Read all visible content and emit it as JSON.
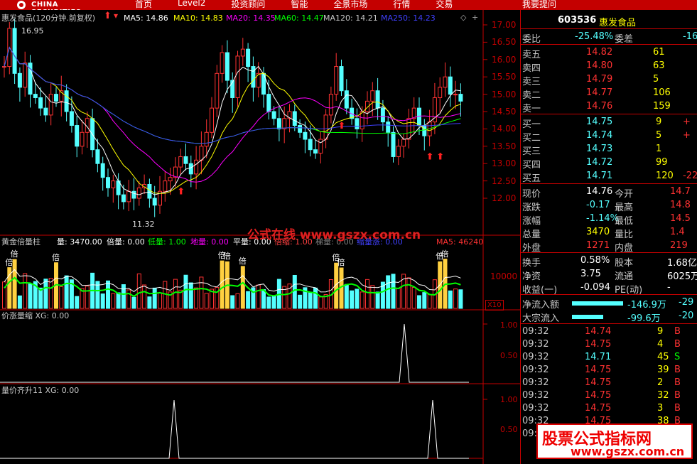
{
  "app": {
    "logo_text": "CHINA SECURITIES",
    "menu": [
      "首页",
      "Level2",
      "投资顾问",
      "智能",
      "全景市场",
      "行情",
      "交易"
    ],
    "top_right": "我要提问"
  },
  "chart_header": {
    "stock": "惠发食品(120分钟.前复权)",
    "ma5": "MA5: 14.86",
    "ma10": "MA10: 14.83",
    "ma20": "MA20: 14.35",
    "ma60": "MA60: 14.47",
    "ma120": "MA120: 14.21",
    "ma250": "MA250: 14.23",
    "high_mark": "16.95",
    "low_mark": "11.32"
  },
  "price_axis": [
    "17.00",
    "16.50",
    "16.00",
    "15.50",
    "15.00",
    "14.50",
    "14.00",
    "13.50",
    "13.00",
    "12.50",
    "12.00"
  ],
  "vol_header": {
    "name": "黄金倍量柱",
    "liang": "量: 3470.00",
    "beiliang": "倍量: 0.00",
    "diliang": "低量: 1.00",
    "diliang2": "地量: 0.00",
    "pingliang": "平量: 0.00",
    "beisuo": "倍缩: 1.00",
    "tiliang": "梯量: 0.00",
    "suoliang": "缩量涨: 0.00",
    "ma5": "MA5: 46240"
  },
  "vol_axis": {
    "v1": "10000",
    "unit": "X10"
  },
  "vol_bei": "倍",
  "ind1": {
    "title": "价涨量缩 XG: 0.00",
    "y1": "1.00",
    "y2": "0.50"
  },
  "ind2": {
    "title": "量价齐升11 XG: 0.00",
    "y1": "1.00",
    "y2": "0.50"
  },
  "watermark": {
    "center": "公式在线 www.gszx.com.cn",
    "box_line1": "股票公式指标网",
    "box_line2": "www.gszx.com.cn"
  },
  "side": {
    "code": "603536",
    "name": "惠发食品",
    "weibi": {
      "label": "委比",
      "value": "-25.48%",
      "label2": "委差",
      "value2": "-16"
    },
    "asks": [
      {
        "label": "卖五",
        "price": "14.82",
        "vol": "61"
      },
      {
        "label": "卖四",
        "price": "14.80",
        "vol": "63"
      },
      {
        "label": "卖三",
        "price": "14.79",
        "vol": "5"
      },
      {
        "label": "卖二",
        "price": "14.77",
        "vol": "106"
      },
      {
        "label": "卖一",
        "price": "14.76",
        "vol": "159"
      }
    ],
    "bids": [
      {
        "label": "买一",
        "price": "14.75",
        "vol": "9",
        "extra": "+"
      },
      {
        "label": "买二",
        "price": "14.74",
        "vol": "5",
        "extra": "+"
      },
      {
        "label": "买三",
        "price": "14.73",
        "vol": "1",
        "extra": ""
      },
      {
        "label": "买四",
        "price": "14.72",
        "vol": "99",
        "extra": ""
      },
      {
        "label": "买五",
        "price": "14.71",
        "vol": "120",
        "extra": "-22"
      }
    ],
    "stats": [
      {
        "l1": "现价",
        "v1": "14.76",
        "l2": "今开",
        "v2": "14.7"
      },
      {
        "l1": "涨跌",
        "v1": "-0.17",
        "l2": "最高",
        "v2": "14.8"
      },
      {
        "l1": "涨幅",
        "v1": "-1.14%",
        "l2": "最低",
        "v2": "14.5"
      },
      {
        "l1": "总量",
        "v1": "3470",
        "l2": "量比",
        "v2": "1.4"
      },
      {
        "l1": "外盘",
        "v1": "1271",
        "l2": "内盘",
        "v2": "219"
      }
    ],
    "stats2": [
      {
        "l1": "换手",
        "v1": "0.58%",
        "l2": "股本",
        "v2": "1.68亿"
      },
      {
        "l1": "净资",
        "v1": "3.75",
        "l2": "流通",
        "v2": "6025万"
      },
      {
        "l1": "收益(一)",
        "v1": "-0.094",
        "l2": "PE(动)",
        "v2": "-"
      }
    ],
    "flows": [
      {
        "label": "净流入额",
        "value": "-146.9万",
        "pct": "-29"
      },
      {
        "label": "大宗流入",
        "value": "-99.6万",
        "pct": "-20"
      }
    ],
    "ticks": [
      {
        "t": "09:32",
        "p": "14.74",
        "v": "9",
        "s": "B"
      },
      {
        "t": "09:32",
        "p": "14.75",
        "v": "4",
        "s": "B"
      },
      {
        "t": "09:32",
        "p": "14.71",
        "v": "45",
        "s": "S"
      },
      {
        "t": "09:32",
        "p": "14.75",
        "v": "39",
        "s": "B"
      },
      {
        "t": "09:32",
        "p": "14.75",
        "v": "2",
        "s": "B"
      },
      {
        "t": "09:32",
        "p": "14.75",
        "v": "32",
        "s": "B"
      },
      {
        "t": "09:32",
        "p": "14.75",
        "v": "3",
        "s": "B"
      },
      {
        "t": "09:32",
        "p": "14.75",
        "v": "38",
        "s": "B"
      },
      {
        "t": "09:33",
        "p": "",
        "v": "",
        "s": ""
      }
    ]
  },
  "colors": {
    "up": "#ff3232",
    "down": "#54ffff",
    "ma5": "#ffffff",
    "ma10": "#ffff00",
    "ma20": "#ff00ff",
    "ma60": "#00ff00",
    "ma250": "#4040ff"
  }
}
